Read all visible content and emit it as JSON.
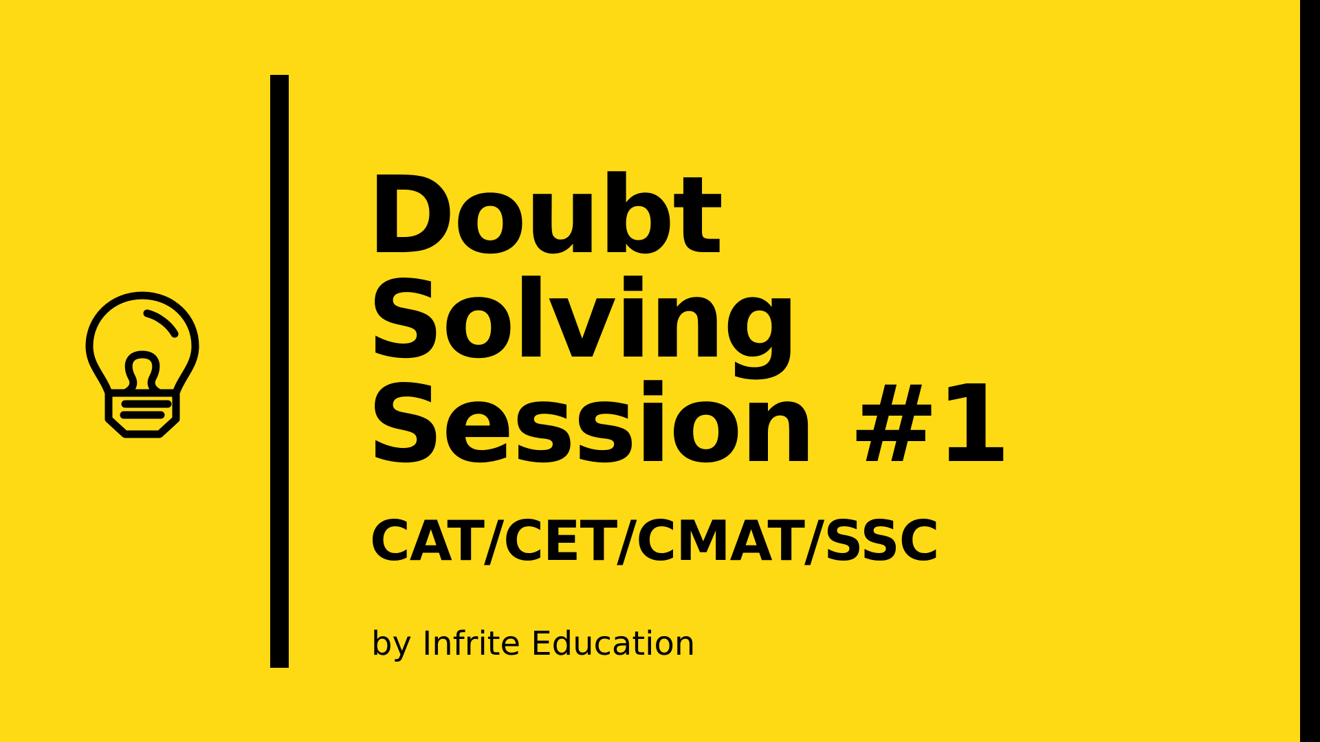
{
  "colors": {
    "background": "#FEDA15",
    "ink": "#000000"
  },
  "icon": {
    "name": "lightbulb-icon"
  },
  "title": {
    "line1": "Doubt",
    "line2": "Solving",
    "line3": "Session #1"
  },
  "subtitle": "CAT/CET/CMAT/SSC",
  "byline": "by Infrite Education"
}
